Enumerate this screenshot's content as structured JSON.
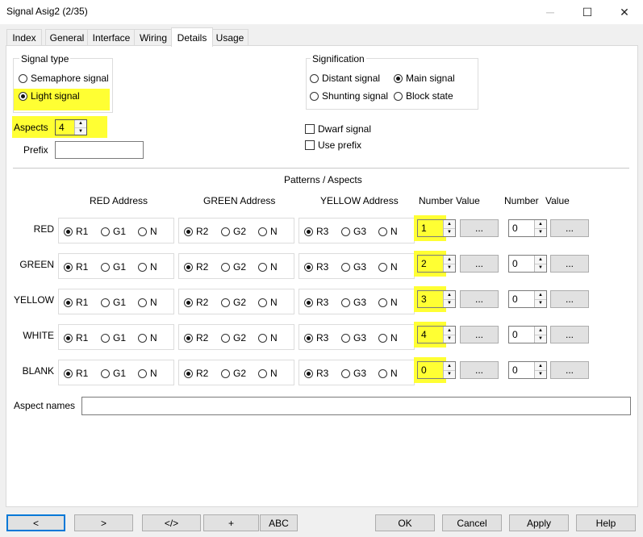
{
  "window": {
    "title": "Signal Asig2 (2/35)",
    "min": "─",
    "max": "☐",
    "close": "✕"
  },
  "tabs": [
    "Index",
    "General",
    "Interface",
    "Wiring",
    "Details",
    "Usage"
  ],
  "signal_type": {
    "label": "Signal type",
    "options": [
      "Semaphore signal",
      "Light signal"
    ],
    "selected": "Light signal"
  },
  "signification": {
    "label": "Signification",
    "options": [
      "Distant signal",
      "Main signal",
      "Shunting signal",
      "Block state"
    ],
    "selected": "Main signal"
  },
  "aspects": {
    "label": "Aspects",
    "value": "4"
  },
  "prefix": {
    "label": "Prefix",
    "value": ""
  },
  "checkboxes": {
    "dwarf": "Dwarf signal",
    "use_prefix": "Use prefix"
  },
  "patterns": {
    "title": "Patterns / Aspects",
    "headers": {
      "red": "RED Address",
      "green": "GREEN Address",
      "yellow": "YELLOW Address",
      "number_value1": "Number Value",
      "number2": "Number",
      "value2": "Value"
    },
    "rows": [
      {
        "label": "RED",
        "num1": "1",
        "num2": "0"
      },
      {
        "label": "GREEN",
        "num1": "2",
        "num2": "0"
      },
      {
        "label": "YELLOW",
        "num1": "3",
        "num2": "0"
      },
      {
        "label": "WHITE",
        "num1": "4",
        "num2": "0"
      },
      {
        "label": "BLANK",
        "num1": "0",
        "num2": "0"
      }
    ],
    "red_opts": [
      "R1",
      "G1",
      "N"
    ],
    "green_opts": [
      "R2",
      "G2",
      "N"
    ],
    "yellow_opts": [
      "R3",
      "G3",
      "N"
    ],
    "ellipsis": "..."
  },
  "aspect_names": {
    "label": "Aspect names",
    "value": ""
  },
  "bottom_buttons": {
    "prev": "<",
    "next": ">",
    "code": "</>",
    "plus": "+",
    "abc": "ABC",
    "ok": "OK",
    "cancel": "Cancel",
    "apply": "Apply",
    "help": "Help"
  },
  "highlight_color": "#ffff33"
}
